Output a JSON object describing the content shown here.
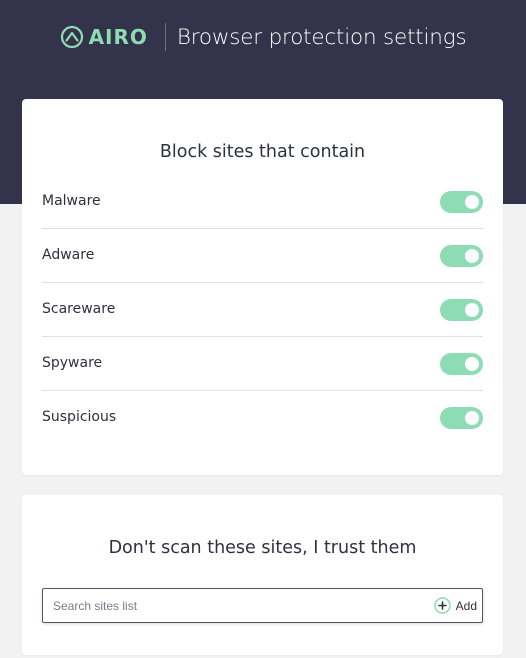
{
  "header": {
    "brand": "AIRO",
    "title": "Browser protection settings"
  },
  "block_sites": {
    "title": "Block sites that contain",
    "items": [
      {
        "label": "Malware",
        "enabled": true
      },
      {
        "label": "Adware",
        "enabled": true
      },
      {
        "label": "Scareware",
        "enabled": true
      },
      {
        "label": "Spyware",
        "enabled": true
      },
      {
        "label": "Suspicious",
        "enabled": true
      }
    ]
  },
  "trusted_sites": {
    "title": "Don't scan these sites, I trust them",
    "search_placeholder": "Search sites list",
    "add_label": "Add"
  },
  "colors": {
    "header_bg": "#33344b",
    "accent": "#8edcb4",
    "page_bg": "#f2f2f3"
  },
  "icons": [
    "airo-logo-icon",
    "plus-circle-icon"
  ]
}
